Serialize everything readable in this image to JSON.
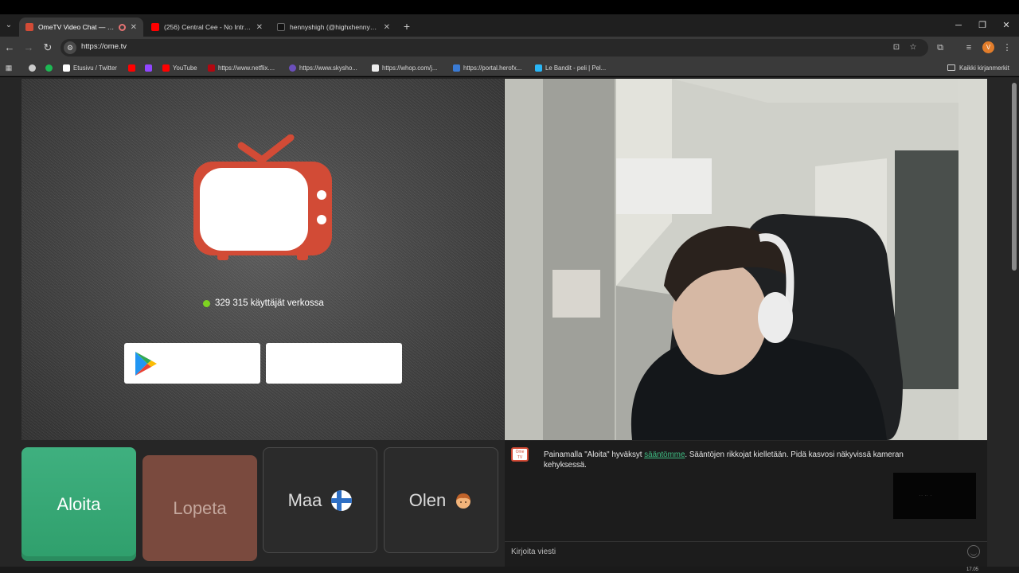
{
  "browser": {
    "tabs": [
      {
        "label": "OmeTV Video Chat — Ome",
        "active": true,
        "favicon_color": "#d24b36"
      },
      {
        "label": "(256) Central Cee - No Introdu",
        "active": false,
        "favicon_color": "#ff0000"
      },
      {
        "label": "hennyshigh (@highxhennyfn) |",
        "active": false,
        "favicon_color": "#111111"
      }
    ],
    "url": "https://ome.tv",
    "bookmarks": [
      {
        "label": "",
        "icon": "globe-icon",
        "color": "#cccccc"
      },
      {
        "label": "",
        "icon": "spotify-icon",
        "color": "#1db954"
      },
      {
        "label": "Etusivu / Twitter",
        "icon": "x-icon",
        "color": "#ffffff"
      },
      {
        "label": "",
        "icon": "youtube-icon",
        "color": "#ff0000"
      },
      {
        "label": "",
        "icon": "twitch-icon",
        "color": "#9146ff"
      },
      {
        "label": "YouTube",
        "icon": "youtube-icon",
        "color": "#ff0000"
      },
      {
        "label": "https://www.netflix....",
        "icon": "netflix-icon",
        "color": "#b20710"
      },
      {
        "label": "https://www.skysho...",
        "icon": "sky-icon",
        "color": "#6b4fbb"
      },
      {
        "label": "https://whop.com/j...",
        "icon": "whop-icon",
        "color": "#eeeeee"
      },
      {
        "label": "https://portal.herofx...",
        "icon": "herofx-icon",
        "color": "#3a7bd5"
      },
      {
        "label": "Le Bandit - peli | Pel...",
        "icon": "bandit-icon",
        "color": "#29b6f6"
      }
    ],
    "all_bookmarks_label": "Kaikki kirjanmerkit",
    "profile_initial": "V"
  },
  "page": {
    "online_text": "329 315 käyttäjät verkossa",
    "buttons": {
      "start": "Aloita",
      "stop": "Lopeta",
      "country": "Maa",
      "gender": "Olen"
    },
    "chat": {
      "message_before": "Painamalla \"Aloita\" hyväksyt ",
      "message_link": "sääntömme",
      "message_after": ". Sääntöjen rikkojat kielletään. Pidä kasvosi näkyvissä kameran kehyksessä.",
      "input_placeholder": "Kirjoita viesti"
    },
    "colors": {
      "start": "#3fb07f",
      "stop": "#7a4a3e",
      "brand": "#d24b36",
      "online_dot": "#7ed321"
    }
  },
  "system": {
    "clock": "17.05"
  }
}
